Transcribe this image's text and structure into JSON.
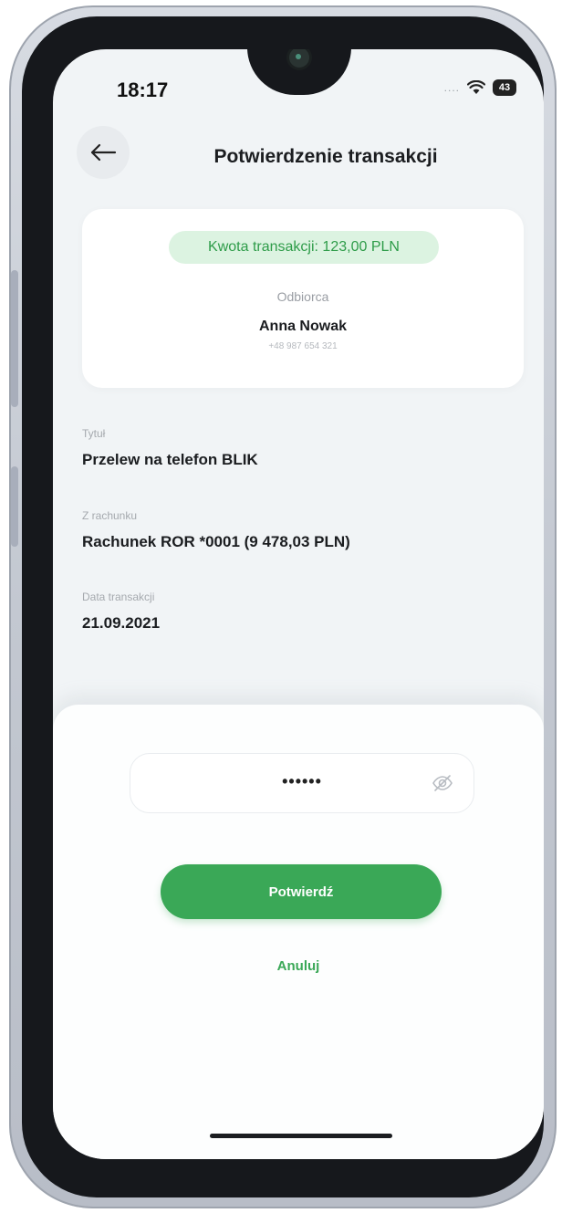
{
  "status_bar": {
    "time": "18:17",
    "signal_dots": "....",
    "battery": "43"
  },
  "header": {
    "back_icon": "arrow-left-icon",
    "title": "Potwierdzenie transakcji"
  },
  "summary": {
    "amount": "Kwota transakcji: 123,00 PLN",
    "recipient_label": "Odbiorca",
    "recipient_name": "Anna Nowak",
    "recipient_phone": "+48 987 654 321"
  },
  "details": [
    {
      "label": "Tytuł",
      "value": "Przelew na telefon BLIK"
    },
    {
      "label": "Z rachunku",
      "value": "Rachunek ROR *0001 (9 478,03 PLN)"
    },
    {
      "label": "Data transakcji",
      "value": "21.09.2021"
    }
  ],
  "pin_field": {
    "value": "••••••",
    "toggle_icon": "eye-off-icon"
  },
  "actions": {
    "confirm": "Potwierdź",
    "cancel": "Anuluj"
  },
  "colors": {
    "accent": "#3aa857",
    "amount_bg": "#dcf3e1",
    "amount_text": "#2e9c49",
    "screen_bg": "#f1f4f6"
  }
}
